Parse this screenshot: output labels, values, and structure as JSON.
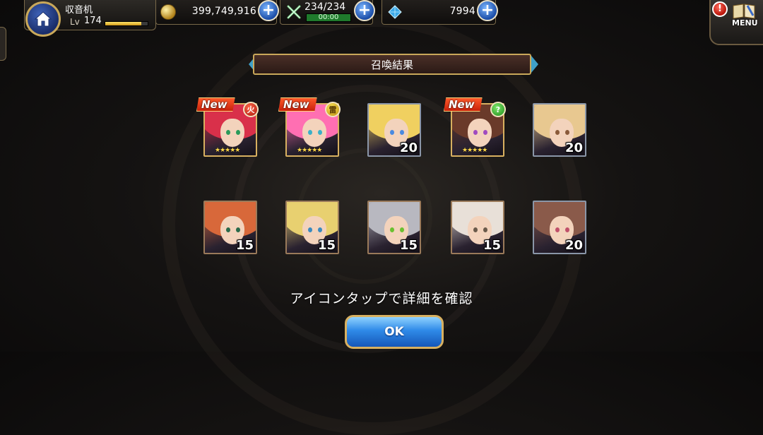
{
  "player": {
    "name": "収音机",
    "level_label": "Lv",
    "level": "174",
    "exp_fraction": 0.85
  },
  "resources": {
    "gold": "399,749,916",
    "stamina": "234/234",
    "stamina_timer": "00:00",
    "gems": "7994",
    "plus_symbol": "+"
  },
  "menu": {
    "label": "MENU",
    "alert": "!"
  },
  "title": "召喚結果",
  "new_label": "New",
  "cards": [
    {
      "is_new": true,
      "element": "fire",
      "stars": "★★★★★",
      "level": "",
      "frame": "gold",
      "hair": "#d9304a",
      "eye": "#2a9a5a"
    },
    {
      "is_new": true,
      "element": "thunder",
      "stars": "★★★★★",
      "level": "",
      "frame": "gold",
      "hair": "#ff6fb2",
      "eye": "#3ab0c8"
    },
    {
      "is_new": false,
      "element": "",
      "stars": "",
      "level": "20",
      "frame": "silver",
      "hair": "#f0d060",
      "eye": "#4a8ae0"
    },
    {
      "is_new": true,
      "element": "wind",
      "stars": "★★★★★",
      "level": "",
      "frame": "gold",
      "hair": "#6a3a2a",
      "eye": "#a04ac0"
    },
    {
      "is_new": false,
      "element": "",
      "stars": "",
      "level": "20",
      "frame": "silver",
      "hair": "#e8c890",
      "eye": "#8a5a3a"
    },
    {
      "is_new": false,
      "element": "",
      "stars": "",
      "level": "15",
      "frame": "bronze",
      "hair": "#d8683a",
      "eye": "#2a6a4a"
    },
    {
      "is_new": false,
      "element": "",
      "stars": "",
      "level": "15",
      "frame": "bronze",
      "hair": "#e8d070",
      "eye": "#3a8ac0"
    },
    {
      "is_new": false,
      "element": "",
      "stars": "",
      "level": "15",
      "frame": "bronze",
      "hair": "#b8b8c0",
      "eye": "#6ac030"
    },
    {
      "is_new": false,
      "element": "",
      "stars": "",
      "level": "15",
      "frame": "bronze",
      "hair": "#e8e0d8",
      "eye": "#6a5a4a"
    },
    {
      "is_new": false,
      "element": "",
      "stars": "",
      "level": "20",
      "frame": "silver",
      "hair": "#8a5a4a",
      "eye": "#c0506a"
    }
  ],
  "element_glyphs": {
    "fire": "火",
    "thunder": "雷",
    "wind": "?"
  },
  "hint": "アイコンタップで詳細を確認",
  "ok_label": "OK"
}
